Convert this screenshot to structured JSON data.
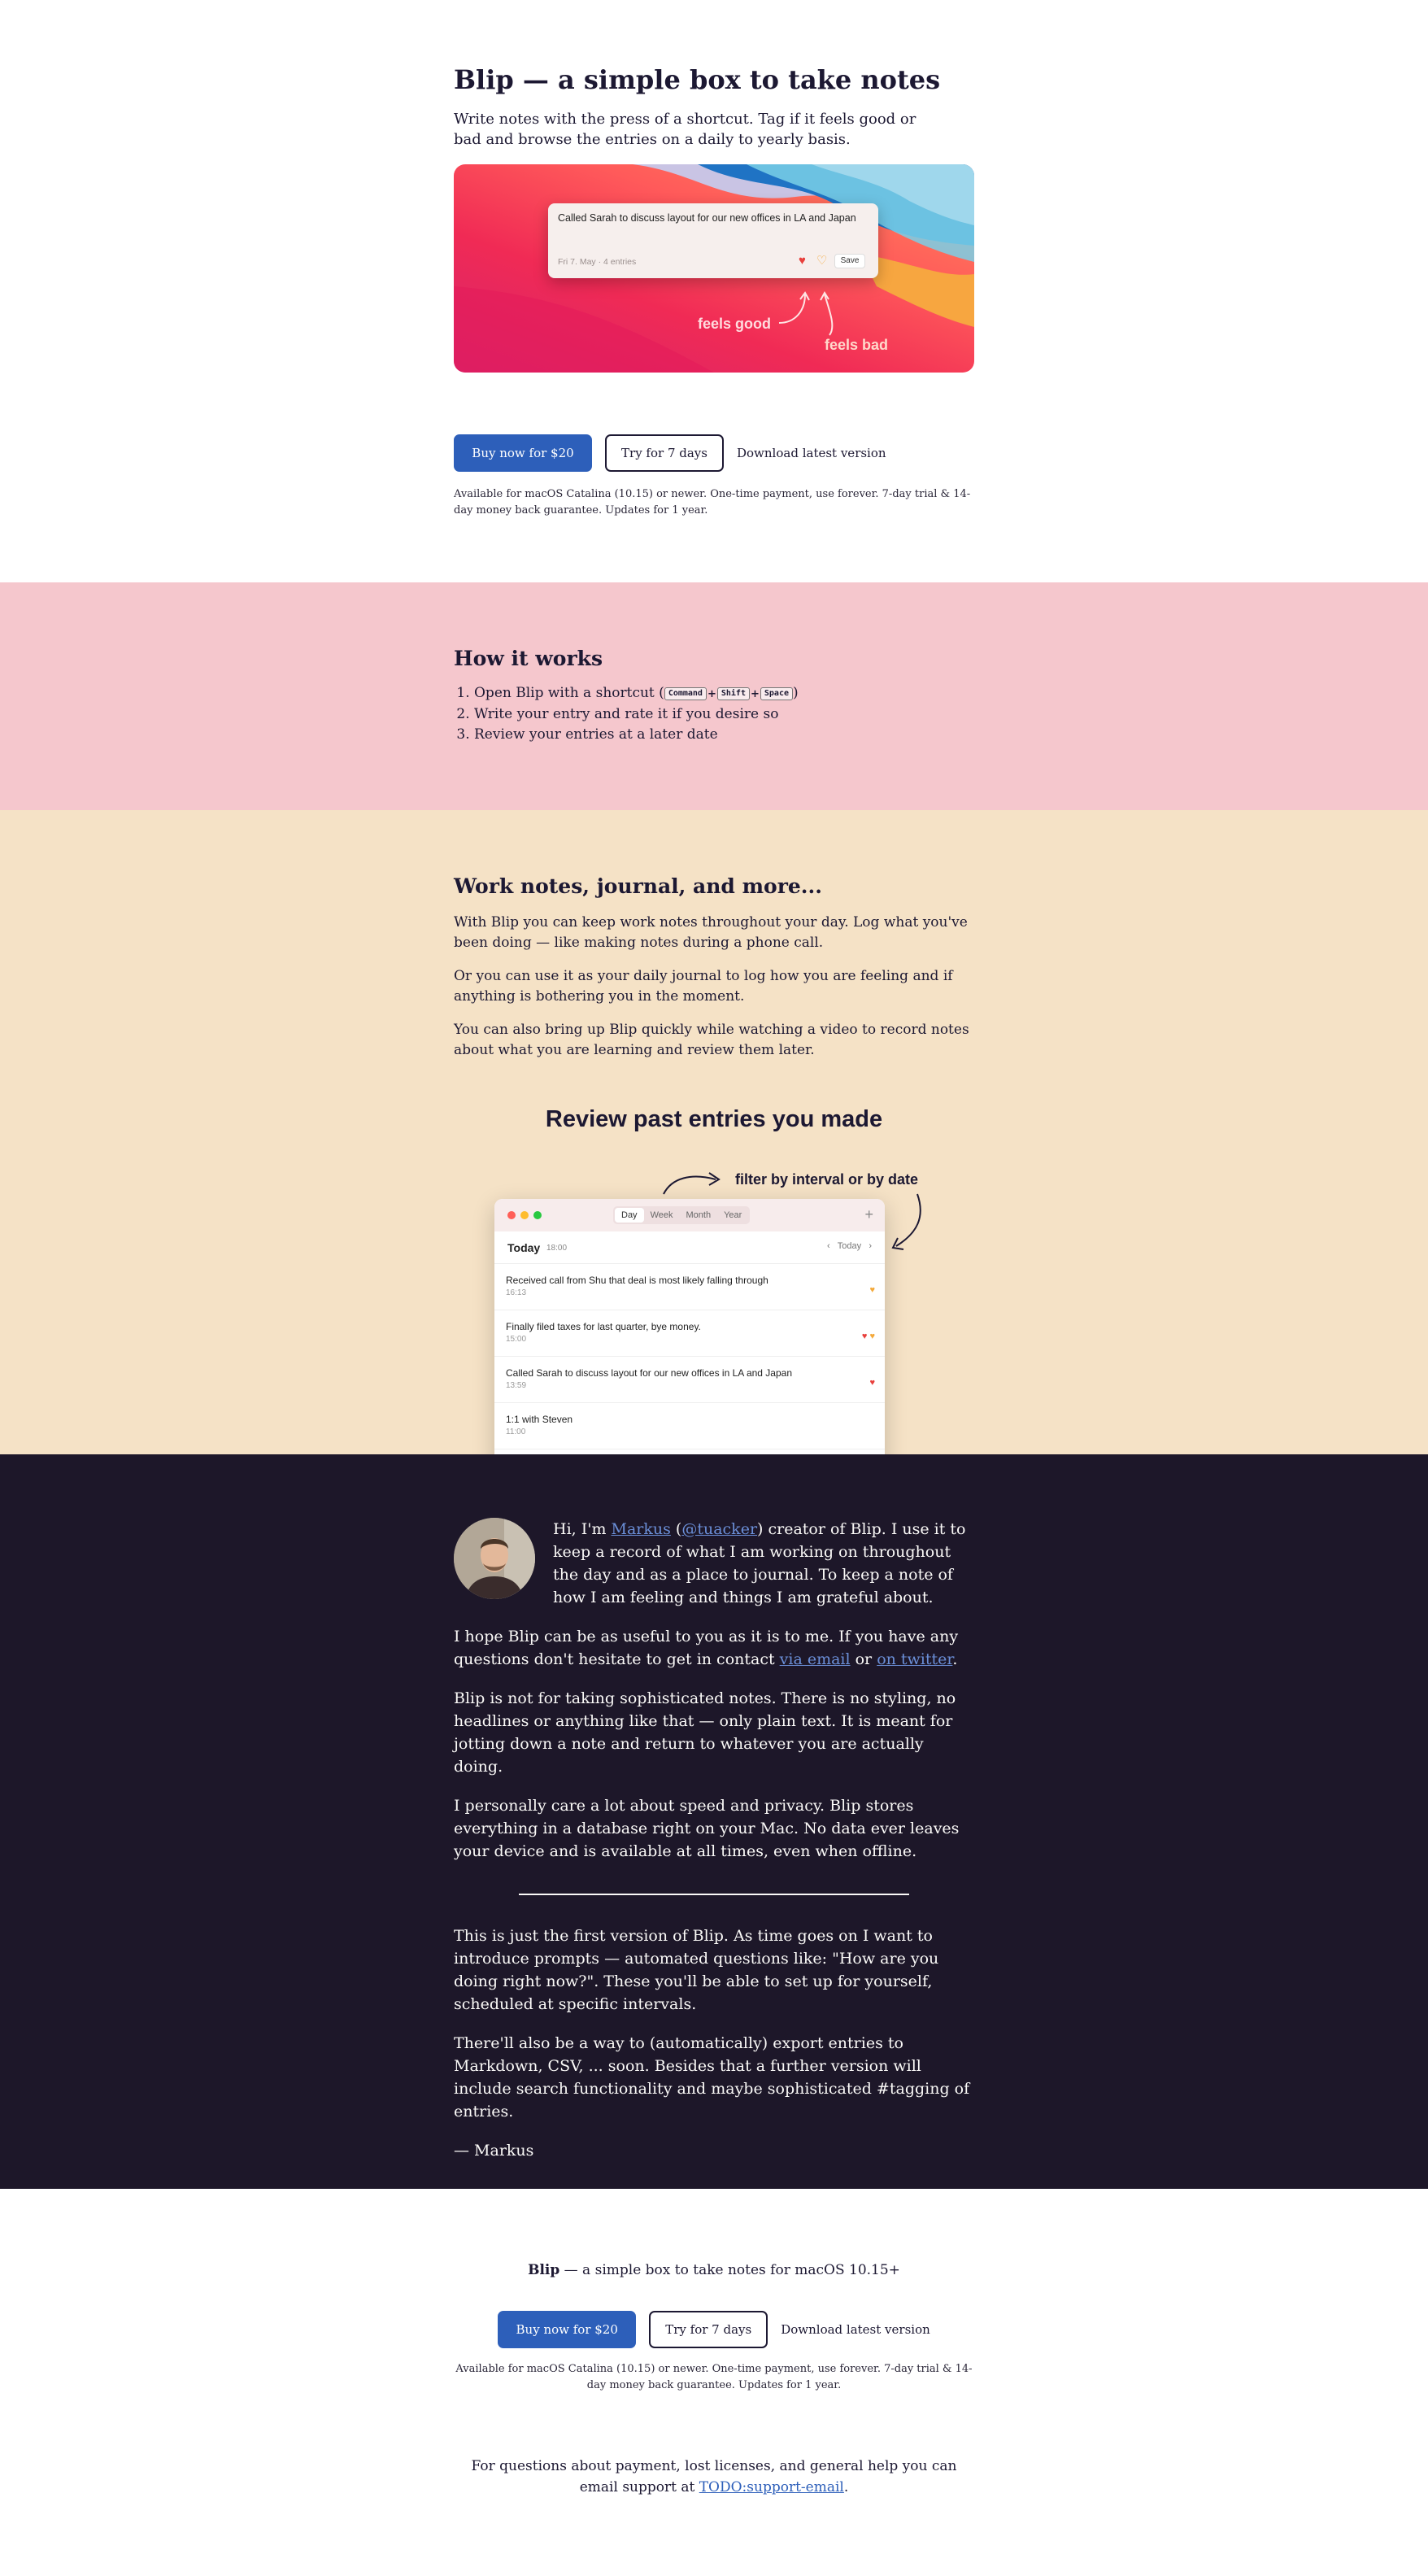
{
  "hero": {
    "title_bold": "Blip",
    "title_rest": " — a simple box to take notes",
    "intro": "Write notes with the press of a shortcut. Tag if it feels good or bad and browse the entries on a daily to yearly basis.",
    "screenshot": {
      "note_text": "Called Sarah to discuss layout for our new offices in LA and Japan",
      "note_meta": "Fri 7. May · 4 entries",
      "save_label": "Save",
      "label_good": "feels good",
      "label_bad": "feels bad"
    },
    "buy_label": "Buy now for $20",
    "try_label": "Try for 7 days",
    "download_label": "Download latest version",
    "fine_print": "Available for macOS Catalina (10.15) or newer. One-time payment, use forever. 7-day trial & 14-day money back guarantee. Updates for 1 year."
  },
  "how": {
    "title": "How it works",
    "step1_prefix": "Open Blip with a shortcut (",
    "step1_suffix": ")",
    "keys": [
      "Command",
      "Shift",
      "Space"
    ],
    "step2": "Write your entry and rate it if you desire so",
    "step3": "Review your entries at a later date"
  },
  "work": {
    "title": "Work notes, journal, and more...",
    "p1": "With Blip you can keep work notes throughout your day. Log what you've been doing — like making notes during a phone call.",
    "p2": "Or you can use it as your daily journal to log how you are feeling and if anything is bothering you in the moment.",
    "p3": "You can also bring up Blip quickly while watching a video to record notes about what you are learning and review them later.",
    "review_title": "Review past entries you made",
    "filter_label": "filter by interval or by date",
    "app": {
      "tabs": [
        "Day",
        "Week",
        "Month",
        "Year"
      ],
      "day_label": "Today",
      "day_time": "18:00",
      "today_btn": "Today",
      "entries": [
        {
          "text": "Received call from Shu that deal is most likely falling through",
          "time": "16:13"
        },
        {
          "text": "Finally filed taxes for last quarter, bye money.",
          "time": "15:00"
        },
        {
          "text": "Called Sarah to discuss layout for our new offices in LA and Japan",
          "time": "13:59"
        },
        {
          "text": "1:1 with Steven",
          "time": "11:00"
        }
      ]
    }
  },
  "about": {
    "bio_1": "Hi, I'm ",
    "bio_name": "Markus",
    "bio_2": " (",
    "bio_handle": "@tuacker",
    "bio_3": ") creator of Blip. I use it to keep a record of what I am working on throughout the day and as a place to journal. To keep a note of how I am feeling and things I am grateful about.",
    "p2a": "I hope Blip can be as useful to you as it is to me. If you have any questions don't hesitate to get in contact ",
    "p2_link1": "via email",
    "p2b": " or ",
    "p2_link2": "on twitter",
    "p2c": ".",
    "p3": "Blip is not for taking sophisticated notes. There is no styling, no headlines or anything like that — only plain text. It is meant for jotting down a note and return to whatever you are actually doing.",
    "p4": "I personally care a lot about speed and privacy. Blip stores everything in a database right on your Mac. No data ever leaves your device and is available at all times, even when offline.",
    "p5": "This is just the first version of Blip. As time goes on I want to introduce prompts — automated questions like: \"How are you doing right now?\". These you'll be able to set up for yourself, scheduled at specific intervals.",
    "p6": "There'll also be a way to (automatically) export entries to Markdown, CSV, ... soon. Besides that a further version will include search functionality and maybe sophisticated #tagging of entries.",
    "signoff": "— Markus"
  },
  "footer": {
    "tag_bold": "Blip",
    "tag_rest": " — a simple box to take notes for macOS 10.15+",
    "buy_label": "Buy now for $20",
    "try_label": "Try for 7 days",
    "download_label": "Download latest version",
    "fine_print": "Available for macOS Catalina (10.15) or newer. One-time payment, use forever. 7-day trial & 14-day money back guarantee. Updates for 1 year.",
    "help_text": "For questions about payment, lost licenses, and general help you can email support at ",
    "help_link": "TODO:support-email",
    "help_end": "."
  },
  "colors": {
    "accent": "#2d5fba",
    "ink": "#1c1832",
    "pink_section": "#f5c7cd",
    "beige_section": "#f5e2c6",
    "dark_section": "#1d1729"
  }
}
